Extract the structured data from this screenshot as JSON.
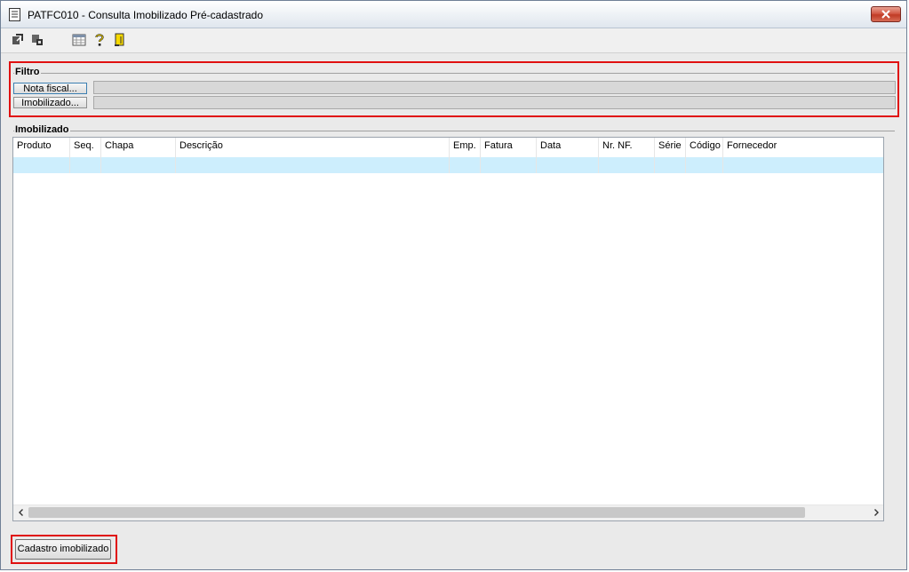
{
  "window": {
    "title": "PATFC010 - Consulta Imobilizado Pré-cadastrado",
    "close_icon": "close-icon"
  },
  "toolbar": {
    "icons": [
      "import-icon",
      "export-icon",
      "calendar-icon",
      "help-icon",
      "exit-icon"
    ]
  },
  "filtro": {
    "title": "Filtro",
    "buttons": [
      {
        "label": "Nota fiscal...",
        "value": ""
      },
      {
        "label": "Imobilizado...",
        "value": ""
      }
    ]
  },
  "imobilizado": {
    "title": "Imobilizado",
    "columns": [
      "Produto",
      "Seq.",
      "Chapa",
      "Descrição",
      "Emp.",
      "Fatura",
      "Data",
      "Nr. NF.",
      "Série",
      "Código",
      "Fornecedor"
    ],
    "rows": [
      [
        "",
        "",
        "",
        "",
        "",
        "",
        "",
        "",
        "",
        "",
        ""
      ]
    ],
    "selected_row_color": "#cdeefd"
  },
  "actions": {
    "cadastro_label": "Cadastro imobilizado"
  },
  "colors": {
    "highlight": "#e01010",
    "close_button": "#c03b25"
  }
}
